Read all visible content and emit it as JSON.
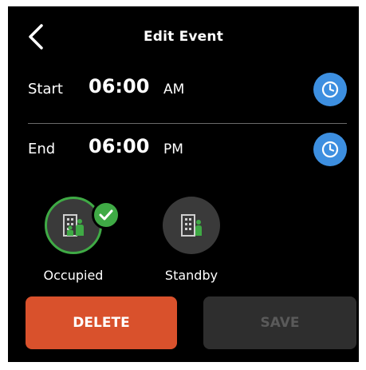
{
  "header": {
    "title": "Edit Event",
    "back_icon": "chevron-left-icon"
  },
  "start": {
    "label": "Start",
    "time": "06:00",
    "ampm": "AM",
    "icon": "clock-icon"
  },
  "end": {
    "label": "End",
    "time": "06:00",
    "ampm": "PM",
    "icon": "clock-icon"
  },
  "modes": [
    {
      "label": "Occupied",
      "icon": "building-occupied-icon",
      "selected": true
    },
    {
      "label": "Standby",
      "icon": "building-standby-icon",
      "selected": false
    }
  ],
  "buttons": {
    "delete_label": "DELETE",
    "save_label": "SAVE"
  },
  "colors": {
    "background": "#000000",
    "accent_blue": "#3d8fe0",
    "selected_green": "#3faa45",
    "delete_orange": "#d9512c",
    "disabled_gray": "#2e2e2e"
  }
}
